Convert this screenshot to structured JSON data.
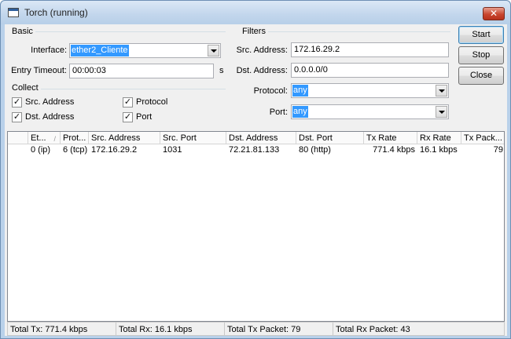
{
  "window": {
    "title": "Torch (running)",
    "close_glyph": "✕",
    "icon": "window-icon"
  },
  "basic": {
    "heading": "Basic",
    "interface_label": "Interface:",
    "interface_value": "ether2_Cliente",
    "entry_timeout_label": "Entry Timeout:",
    "entry_timeout_value": "00:00:03",
    "entry_timeout_unit": "s"
  },
  "collect": {
    "heading": "Collect",
    "checkboxes": [
      {
        "label": "Src. Address",
        "checked": true
      },
      {
        "label": "Protocol",
        "checked": true
      },
      {
        "label": "Dst. Address",
        "checked": true
      },
      {
        "label": "Port",
        "checked": true
      }
    ],
    "check_glyph": "✓"
  },
  "filters": {
    "heading": "Filters",
    "src_address_label": "Src. Address:",
    "src_address_value": "172.16.29.2",
    "dst_address_label": "Dst. Address:",
    "dst_address_value": "0.0.0.0/0",
    "protocol_label": "Protocol:",
    "protocol_value": "any",
    "port_label": "Port:",
    "port_value": "any"
  },
  "buttons": {
    "start": "Start",
    "stop": "Stop",
    "close": "Close"
  },
  "table": {
    "columns": [
      "Et...",
      "Prot...",
      "Src. Address",
      "Src. Port",
      "Dst. Address",
      "Dst. Port",
      "Tx Rate",
      "Rx Rate",
      "Tx Pack..."
    ],
    "sort_glyph": "/",
    "rows": [
      [
        "0 (ip)",
        "6 (tcp)",
        "172.16.29.2",
        "1031",
        "72.21.81.133",
        "80 (http)",
        "771.4 kbps",
        "16.1 kbps",
        "79"
      ]
    ]
  },
  "status": {
    "total_tx": "Total Tx: 771.4 kbps",
    "total_rx": "Total Rx: 16.1 kbps",
    "total_tx_packet": "Total Tx Packet: 79",
    "total_rx_packet": "Total Rx Packet: 43"
  }
}
